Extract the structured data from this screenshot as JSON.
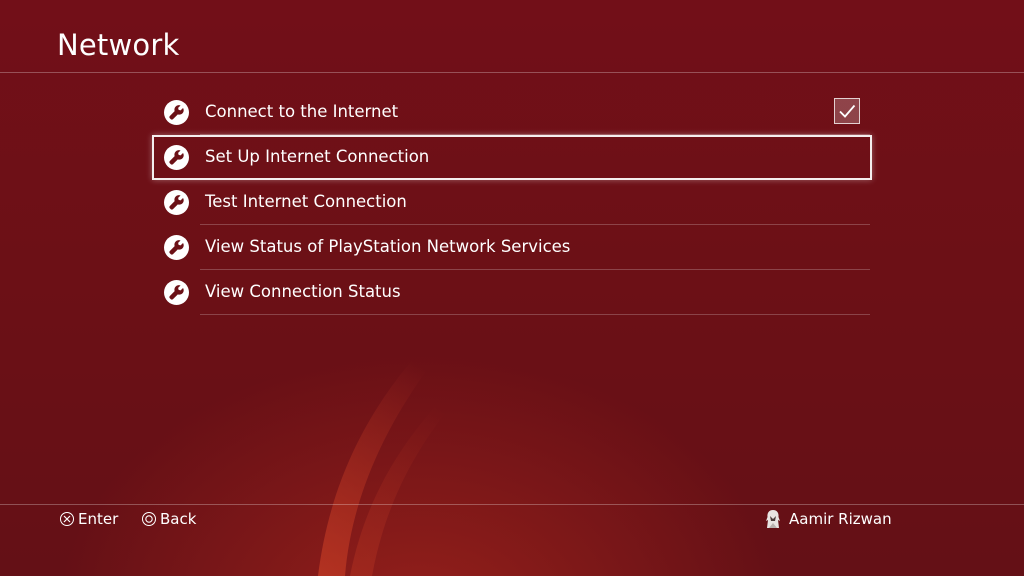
{
  "header": {
    "title": "Network"
  },
  "menu": {
    "items": [
      {
        "label": "Connect to the Internet",
        "icon": "wrench-icon",
        "checked": true,
        "selected": false
      },
      {
        "label": "Set Up Internet Connection",
        "icon": "wrench-icon",
        "selected": true
      },
      {
        "label": "Test Internet Connection",
        "icon": "wrench-icon",
        "selected": false
      },
      {
        "label": "View Status of PlayStation Network Services",
        "icon": "wrench-icon",
        "selected": false
      },
      {
        "label": "View Connection Status",
        "icon": "wrench-icon",
        "selected": false
      }
    ]
  },
  "footer": {
    "enter_label": "Enter",
    "enter_icon": "cross-button-icon",
    "back_label": "Back",
    "back_icon": "circle-button-icon",
    "user_name": "Aamir Rizwan",
    "user_icon": "avatar-icon"
  },
  "colors": {
    "background": "#6b1016",
    "accent": "#ffffff",
    "swoosh": "#c23a24"
  }
}
